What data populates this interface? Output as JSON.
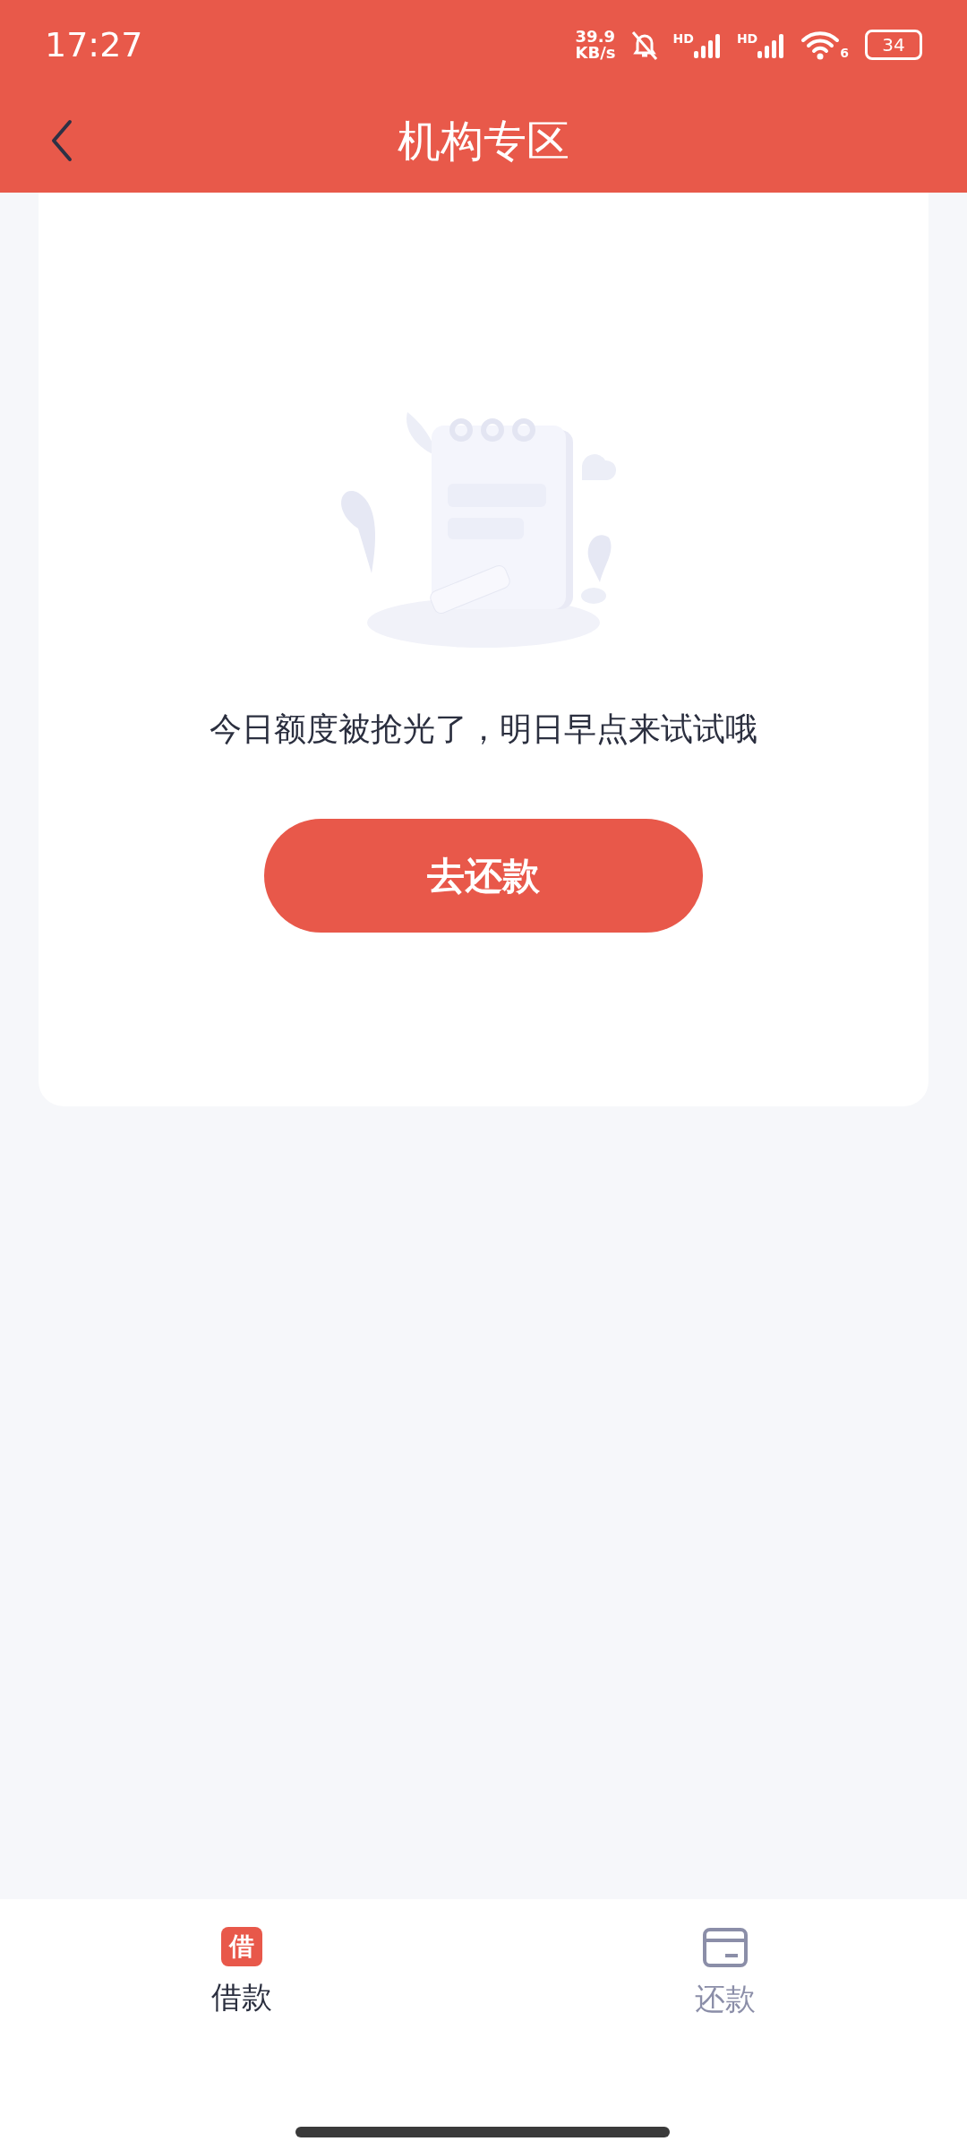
{
  "status_bar": {
    "time": "17:27",
    "net_speed_value": "39.9",
    "net_speed_unit": "KB/s",
    "sim_labels": [
      "HD",
      "HD"
    ],
    "wifi_label": "6",
    "battery": "34"
  },
  "header": {
    "title": "机构专区"
  },
  "empty_state": {
    "message": "今日额度被抢光了，明日早点来试试哦",
    "button": "去还款"
  },
  "tabs": [
    {
      "label": "借款",
      "icon_text": "借",
      "selected": true
    },
    {
      "label": "还款",
      "selected": false
    }
  ]
}
